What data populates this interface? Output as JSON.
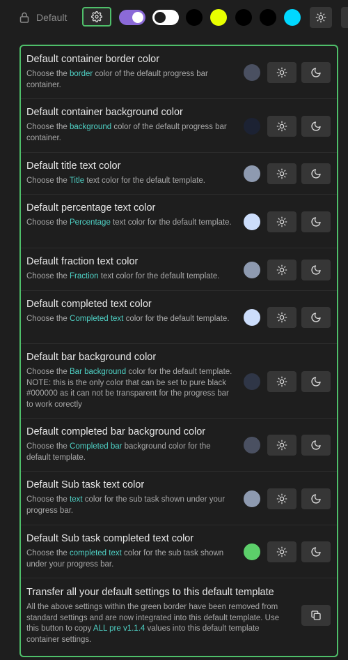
{
  "topbar": {
    "default_label": "Default",
    "toggle_colors": [
      "#8b6ad8",
      "#ffffff"
    ],
    "dot_colors": [
      "#000000",
      "#e8ff00",
      "#000000",
      "#000000",
      "#00d8ff"
    ]
  },
  "settings": [
    {
      "title": "Default container border color",
      "desc": [
        {
          "t": "Choose the "
        },
        {
          "t": "border",
          "h": 1
        },
        {
          "t": " color of the default progress bar container."
        }
      ],
      "color": "#4a5061"
    },
    {
      "title": "Default container background color",
      "desc": [
        {
          "t": "Choose the "
        },
        {
          "t": "background",
          "h": 1
        },
        {
          "t": " color of the default progress bar container."
        }
      ],
      "color": "#1c2233"
    },
    {
      "title": "Default title text color",
      "desc": [
        {
          "t": "Choose the "
        },
        {
          "t": "Title",
          "h": 1
        },
        {
          "t": " text color for the default template."
        }
      ],
      "color": "#8e9ab0"
    },
    {
      "title": "Default percentage text color",
      "desc": [
        {
          "t": "Choose the "
        },
        {
          "t": "Percentage",
          "h": 1
        },
        {
          "t": " text color for the default template."
        }
      ],
      "color": "#ccddfb"
    },
    {
      "title": "Default fraction text color",
      "desc": [
        {
          "t": "Choose the "
        },
        {
          "t": "Fraction",
          "h": 1
        },
        {
          "t": " text color for the default template."
        }
      ],
      "color": "#8e9ab0"
    },
    {
      "title": "Default completed text color",
      "desc": [
        {
          "t": "Choose the "
        },
        {
          "t": "Completed text",
          "h": 1
        },
        {
          "t": " color for the default template."
        }
      ],
      "color": "#ccddfb"
    },
    {
      "title": "Default bar background color",
      "desc": [
        {
          "t": "Choose the "
        },
        {
          "t": "Bar background",
          "h": 1
        },
        {
          "t": " color for the default template. NOTE: this is the only color that can be set to pure black #000000 as it can not be transparent for the progress bar to work corectly"
        }
      ],
      "color": "#2f3647"
    },
    {
      "title": "Default completed bar background color",
      "desc": [
        {
          "t": "Choose the "
        },
        {
          "t": "Completed bar",
          "h": 1
        },
        {
          "t": " background color for the default template."
        }
      ],
      "color": "#4a5061"
    },
    {
      "title": "Default Sub task text color",
      "desc": [
        {
          "t": "Choose the "
        },
        {
          "t": "text",
          "h": 1
        },
        {
          "t": " color for the sub task shown under your progress bar."
        }
      ],
      "color": "#8e9ab0"
    },
    {
      "title": "Default Sub task completed text color",
      "desc": [
        {
          "t": "Choose the "
        },
        {
          "t": "completed text",
          "h": 1
        },
        {
          "t": " color for the sub task shown under your progress bar."
        }
      ],
      "color": "#5ccf6a"
    }
  ],
  "transfer": {
    "title": "Transfer all your default settings to this default template",
    "desc": [
      {
        "t": "All the above settings within the green border have been removed from standard settings and are now integrated into this default template. Use this button to copy "
      },
      {
        "t": "ALL pre v1.1.4",
        "h": 1
      },
      {
        "t": " values into this default template container settings."
      }
    ]
  },
  "icons": {
    "lock": "lock-icon",
    "gear": "gear-icon",
    "sun": "sun-icon",
    "moon": "moon-icon",
    "copy": "copy-icon"
  },
  "accent": "#4fbf6a",
  "highlight": "#4fd1c5"
}
